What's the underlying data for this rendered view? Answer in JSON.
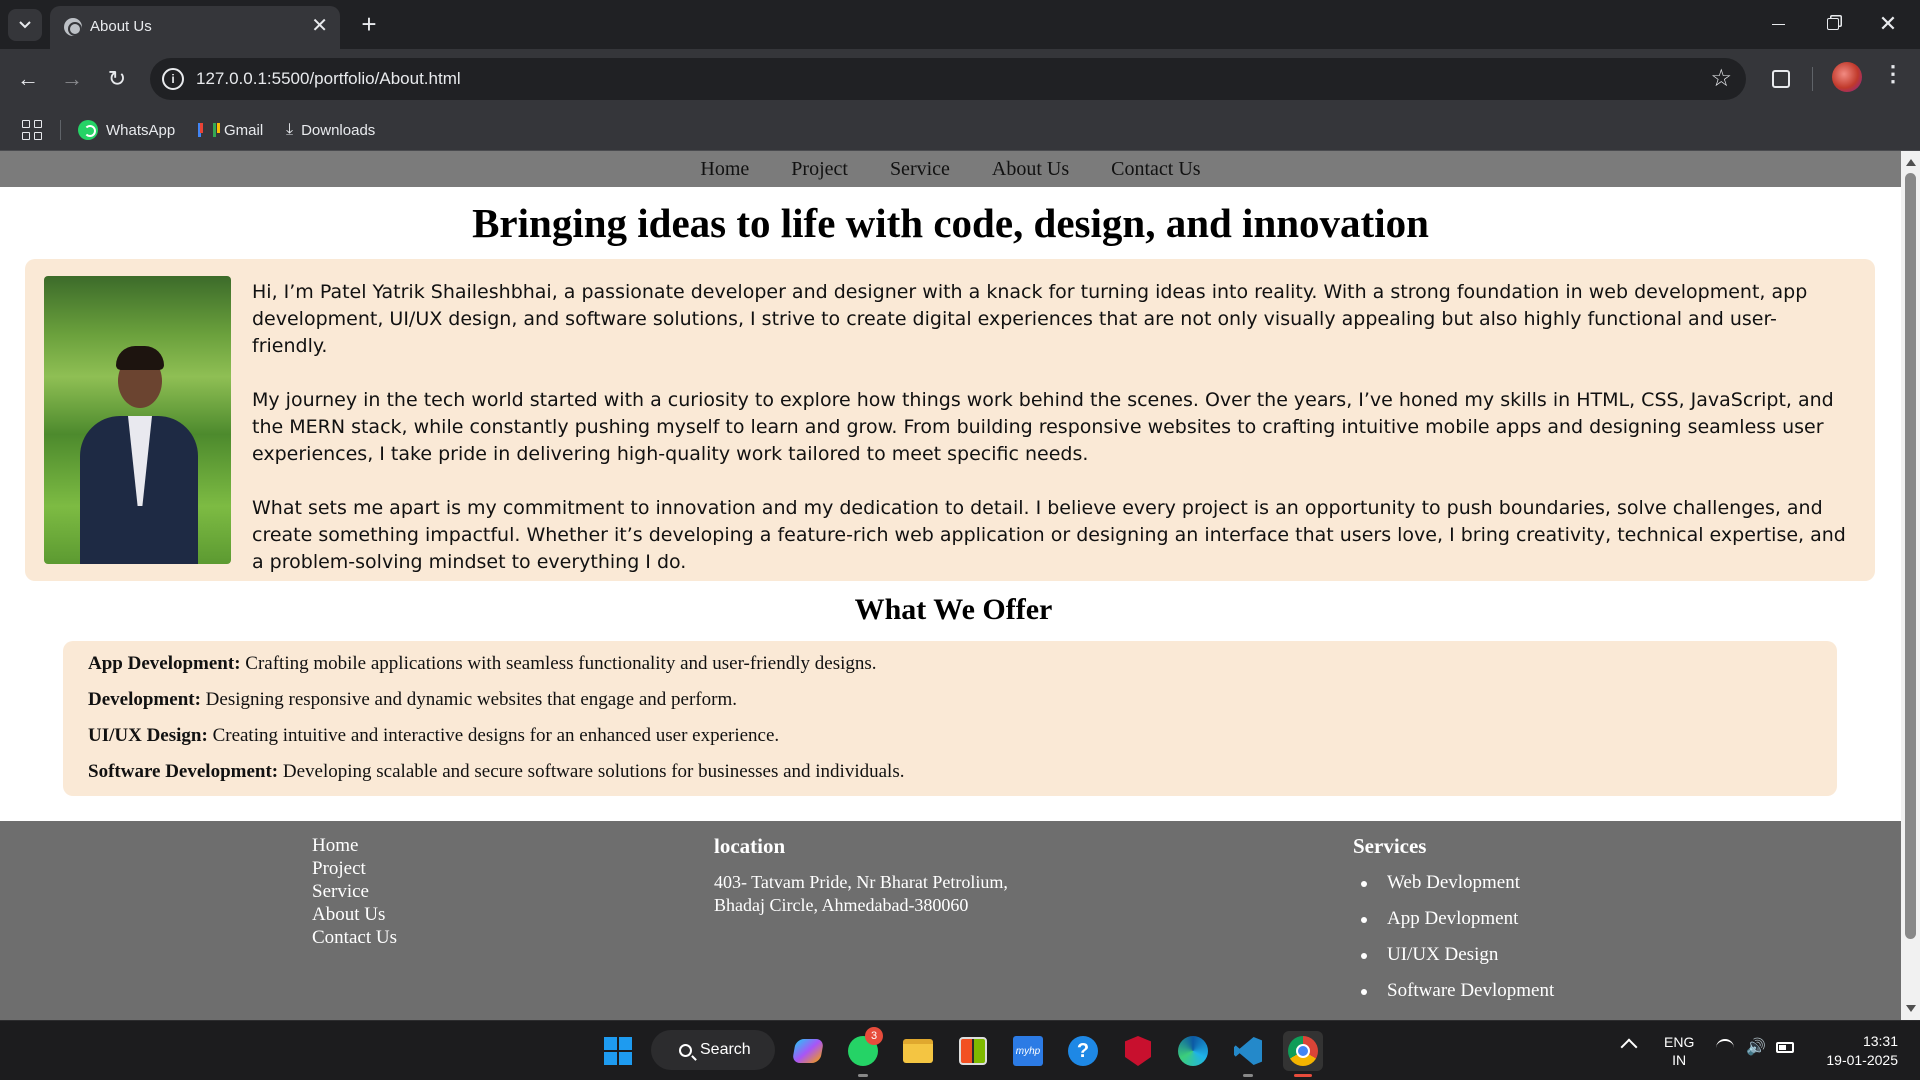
{
  "browser": {
    "tab_title": "About Us",
    "url": "127.0.0.1:5500/portfolio/About.html",
    "bookmarks": [
      {
        "label": "WhatsApp",
        "icon": "whatsapp-icon"
      },
      {
        "label": "Gmail",
        "icon": "gmail-icon"
      },
      {
        "label": "Downloads",
        "icon": "download-icon"
      }
    ]
  },
  "site": {
    "nav": [
      "Home",
      "Project",
      "Service",
      "About Us",
      "Contact Us"
    ],
    "hero_title": "Bringing ideas to life with code, design, and innovation",
    "about_paragraphs": [
      "Hi, I’m Patel Yatrik Shaileshbhai, a passionate developer and designer with a knack for turning ideas into reality. With a strong foundation in web development, app development, UI/UX design, and software solutions, I strive to create digital experiences that are not only visually appealing but also highly functional and user-friendly.",
      "My journey in the tech world started with a curiosity to explore how things work behind the scenes. Over the years, I’ve honed my skills in HTML, CSS, JavaScript, and the MERN stack, while constantly pushing myself to learn and grow. From building responsive websites to crafting intuitive mobile apps and designing seamless user experiences, I take pride in delivering high-quality work tailored to meet specific needs.",
      "What sets me apart is my commitment to innovation and my dedication to detail. I believe every project is an opportunity to push boundaries, solve challenges, and create something impactful. Whether it’s developing a feature-rich web application or designing an interface that users love, I bring creativity, technical expertise, and a problem-solving mindset to everything I do."
    ],
    "offer_title": "What We Offer",
    "offers": [
      {
        "label": "App Development:",
        "text": " Crafting mobile applications with seamless functionality and user-friendly designs."
      },
      {
        "label": "Development:",
        "text": " Designing responsive and dynamic websites that engage and perform."
      },
      {
        "label": "UI/UX Design:",
        "text": " Creating intuitive and interactive designs for an enhanced user experience."
      },
      {
        "label": "Software Development:",
        "text": " Developing scalable and secure software solutions for businesses and individuals."
      }
    ],
    "footer": {
      "links": [
        "Home",
        "Project",
        "Service",
        "About Us",
        "Contact Us"
      ],
      "location_heading": "location",
      "address_line1": "403- Tatvam Pride, Nr Bharat Petrolium,",
      "address_line2": "Bhadaj Circle, Ahmedabad-380060",
      "services_heading": "Services",
      "services": [
        "Web Devlopment",
        "App Devlopment",
        "UI/UX Design",
        "Software Devlopment"
      ]
    }
  },
  "taskbar": {
    "search_label": "Search",
    "whatsapp_badge": "3",
    "lang_line1": "ENG",
    "lang_line2": "IN",
    "time": "13:31",
    "date": "19-01-2025",
    "myhp_label": "myhp",
    "help_label": "?"
  }
}
